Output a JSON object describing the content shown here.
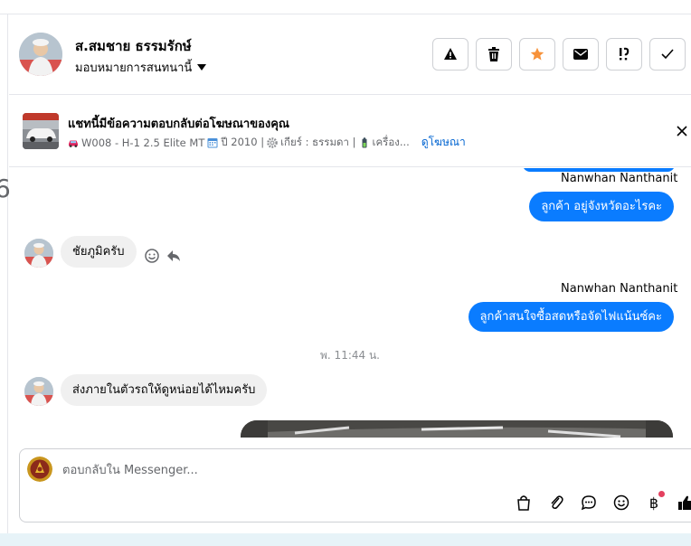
{
  "contact": {
    "name": "ส.สมชาย ธรรมรักษ์",
    "assign_label": "มอบหมายการสนทนานี้"
  },
  "header_actions": [
    {
      "name": "report-button",
      "icon": "warning-icon"
    },
    {
      "name": "delete-button",
      "icon": "trash-icon"
    },
    {
      "name": "star-button",
      "icon": "star-icon"
    },
    {
      "name": "unread-button",
      "icon": "envelope-icon"
    },
    {
      "name": "follow-up-button",
      "icon": "flag-important-icon"
    },
    {
      "name": "done-button",
      "icon": "check-icon"
    }
  ],
  "ad_banner": {
    "title": "แชทนี้มีข้อความตอบกลับต่อโฆษณาของคุณ",
    "code": "W008 - H-1 2.5 Elite MT",
    "year": "ปี 2010 |",
    "gear": "เกียร์ : ธรรมดา |",
    "engine": "เครื่อง...",
    "link_label": "ดูโฆษณา"
  },
  "messages": {
    "sender_1": "Nanwhan Nanthanit",
    "outgoing_1": "ลูกค้า อยู่จังหวัดอะไรคะ",
    "incoming_1": "ชัยภูมิครับ",
    "sender_2": "Nanwhan Nanthanit",
    "outgoing_2": "ลูกค้าสนใจซื้อสดหรือจัดไฟแน้นซ์คะ",
    "timestamp": "พ. 11:44 น.",
    "incoming_2": "ส่งภายในตัวรถให้ดูหน่อยได้ไหมครับ"
  },
  "composer": {
    "placeholder": "ตอบกลับใน Messenger...",
    "currency_symbol": "฿"
  },
  "colors": {
    "accent_blue": "#0a7cff",
    "star_orange": "#f7923a",
    "notification_red": "#e4405f"
  }
}
